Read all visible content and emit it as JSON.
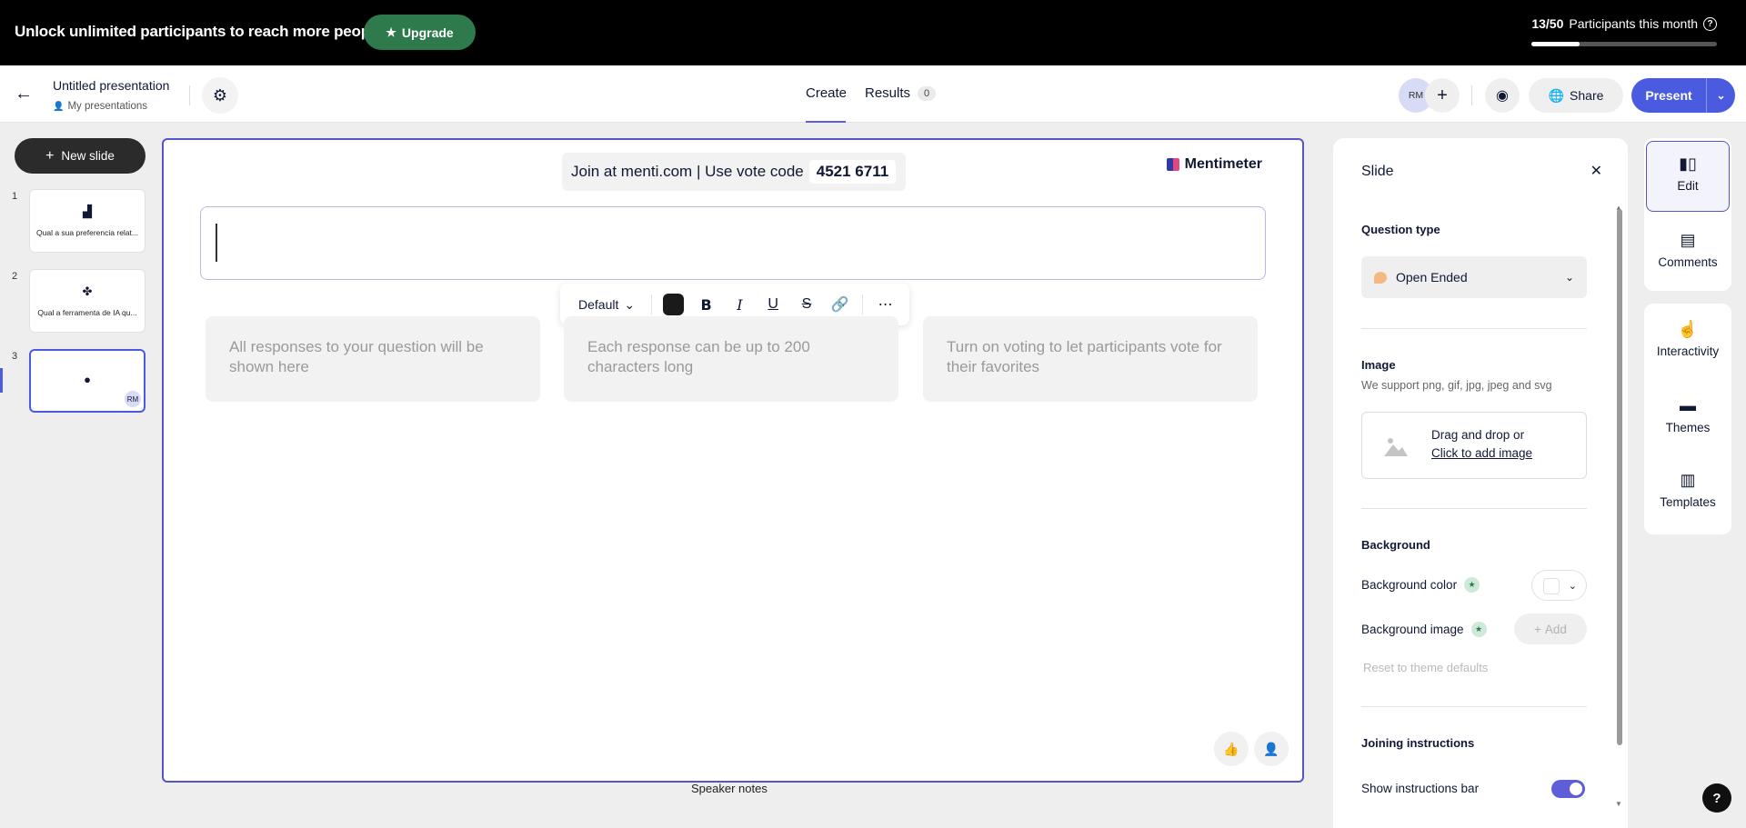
{
  "banner": {
    "message": "Unlock unlimited participants to reach more people.",
    "upgrade_label": "Upgrade",
    "participants_count": "13/50",
    "participants_label": "Participants this month",
    "participants_progress": 0.26
  },
  "header": {
    "title": "Untitled presentation",
    "folder": "My presentations",
    "tabs": {
      "create": "Create",
      "results": "Results",
      "results_count": "0"
    },
    "avatar_initials": "RM",
    "share_label": "Share",
    "present_label": "Present"
  },
  "slides_rail": {
    "new_slide_label": "New slide",
    "slides": [
      {
        "number": "1",
        "title": "Qual a sua preferencia relat...",
        "icon": "bar-chart-icon"
      },
      {
        "number": "2",
        "title": "Qual a ferramenta de IA qu...",
        "icon": "clover-icon"
      },
      {
        "number": "3",
        "title": "",
        "icon": "speech-bubble-icon",
        "badge": "RM"
      }
    ]
  },
  "canvas": {
    "join_text": "Join at menti.com | Use vote code",
    "vote_code": "4521 6711",
    "brand": "Mentimeter",
    "toolbar": {
      "font": "Default",
      "text_color": "#1a1a1a"
    },
    "response_cards": [
      "All responses to your question will be shown here",
      "Each response can be up to 200 characters long",
      "Turn on voting to let participants vote for their favorites"
    ],
    "speaker_notes_label": "Speaker notes"
  },
  "panel": {
    "title": "Slide",
    "question_type_label": "Question type",
    "question_type_value": "Open Ended",
    "image_label": "Image",
    "image_support": "We support png, gif, jpg, jpeg and svg",
    "dropzone_line1": "Drag and drop or",
    "dropzone_link": "Click to add image",
    "background_label": "Background",
    "background_color_label": "Background color",
    "background_image_label": "Background image",
    "add_label": "Add",
    "reset_label": "Reset to theme defaults",
    "joining_label": "Joining instructions",
    "show_instructions_label": "Show instructions bar",
    "show_instructions_on": true
  },
  "side_tabs": {
    "edit": "Edit",
    "comments": "Comments",
    "interactivity": "Interactivity",
    "themes": "Themes",
    "templates": "Templates"
  },
  "colors": {
    "accent": "#4a5bdf",
    "upgrade_green": "#2e7a4d",
    "canvas_border": "#5456c7"
  }
}
